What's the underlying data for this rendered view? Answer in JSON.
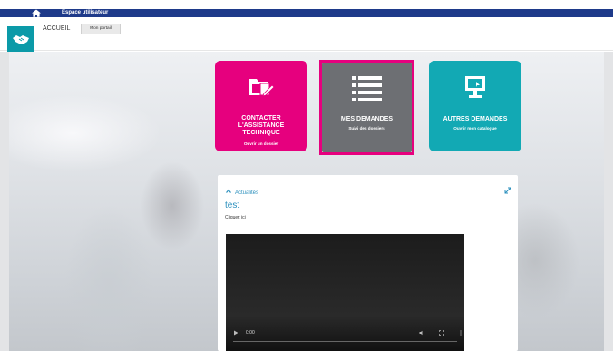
{
  "topbar": {
    "title": "Espace utilisateur",
    "home_icon": "home-icon"
  },
  "header": {
    "breadcrumb": "ACCUEIL",
    "portal_button": "Mon portail",
    "logo_icon": "handshake-icon"
  },
  "tiles": [
    {
      "title": "CONTACTER\nL'ASSISTANCE\nTECHNIQUE",
      "subtitle": "Ouvrir un dossier",
      "icon": "folder-edit-icon",
      "color": "#e6007e"
    },
    {
      "title": "MES DEMANDES",
      "subtitle": "Suivi des dossiers",
      "icon": "list-icon",
      "color": "#6d6f73",
      "selected": true
    },
    {
      "title": "AUTRES DEMANDES",
      "subtitle": "Ouvrir mon catalogue",
      "icon": "desktop-icon",
      "color": "#12a9b4"
    }
  ],
  "card": {
    "header": "Actualités",
    "title": "test",
    "body": "Cliquez ici"
  },
  "video": {
    "time": "0:00"
  },
  "colors": {
    "topbar": "#1e3a8a",
    "pink": "#e6007e",
    "teal": "#12a9b4",
    "link": "#2a8fbd"
  }
}
